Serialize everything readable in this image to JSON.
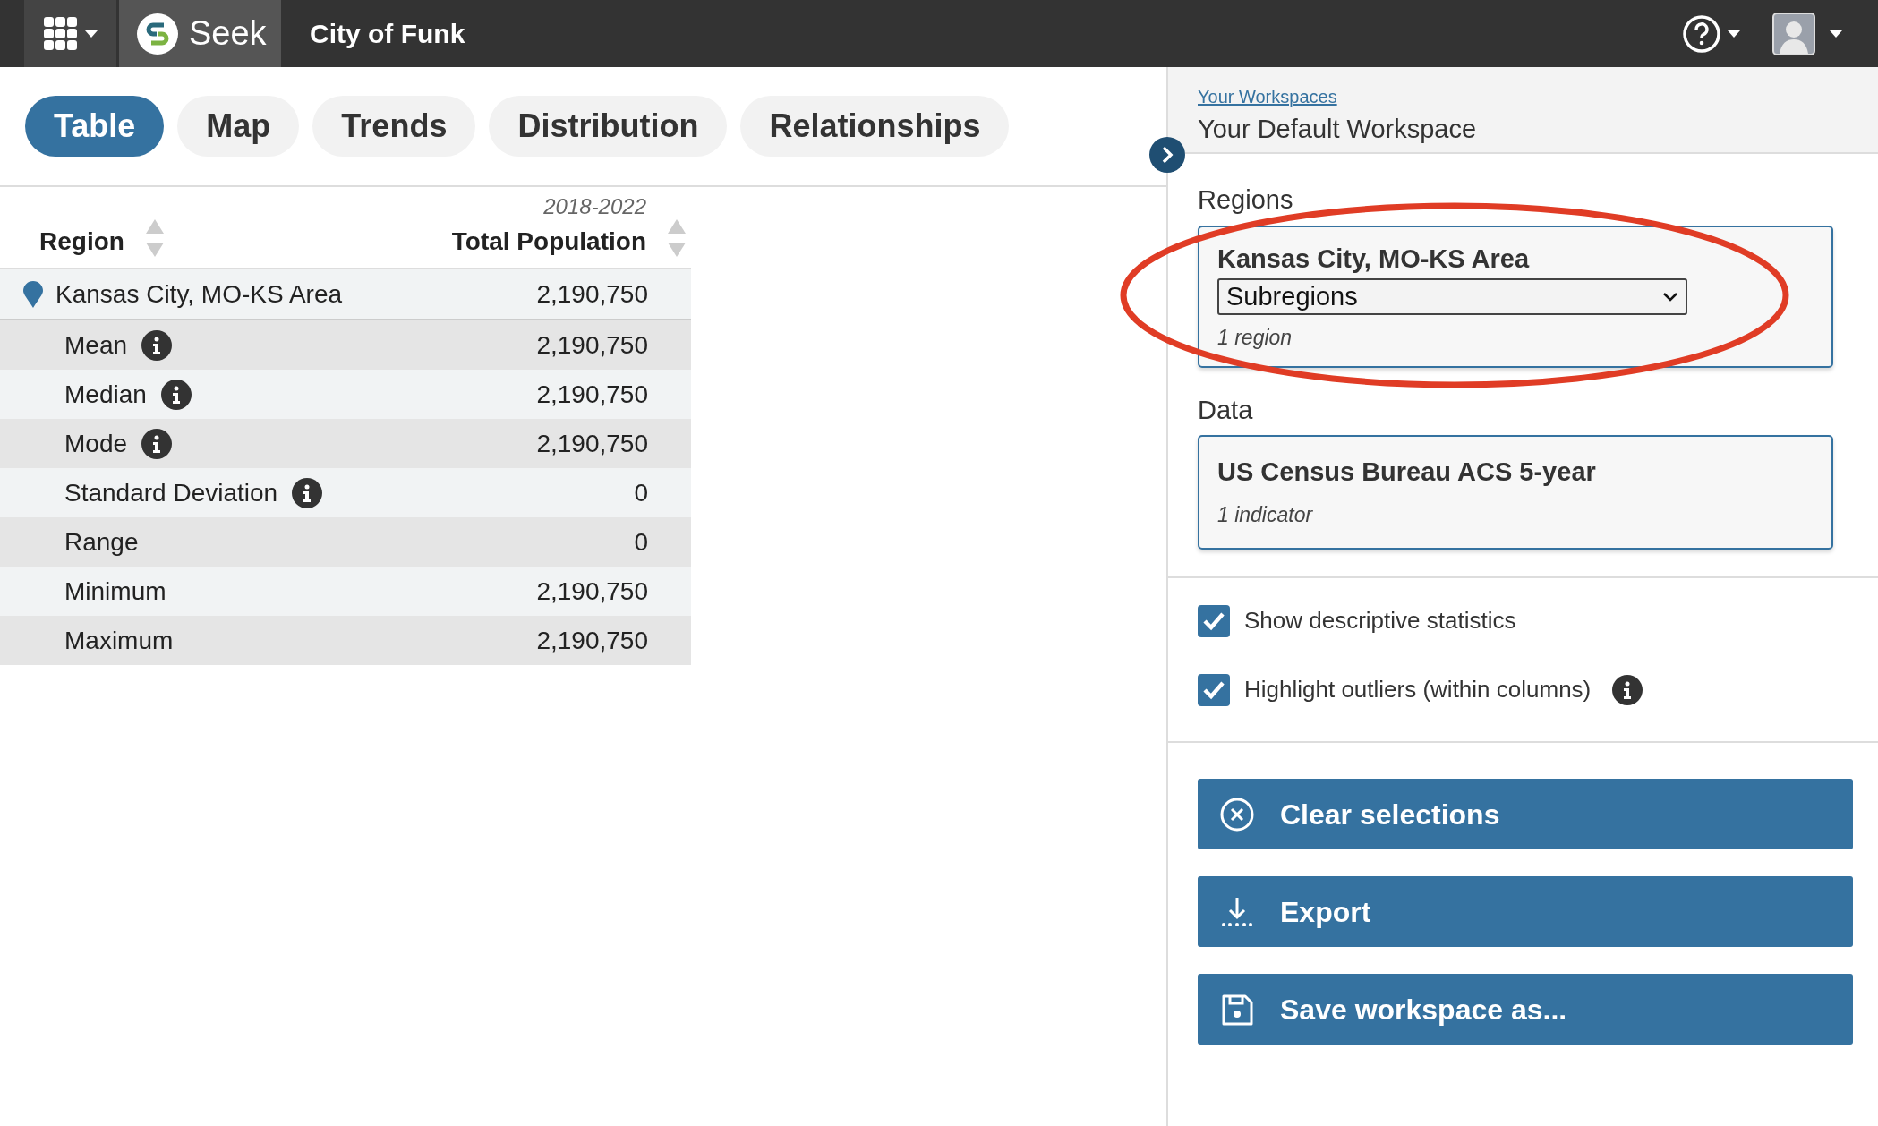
{
  "navbar": {
    "brand": "Seek",
    "title": "City of Funk"
  },
  "tabs": [
    {
      "label": "Table",
      "selected": true
    },
    {
      "label": "Map",
      "selected": false
    },
    {
      "label": "Trends",
      "selected": false
    },
    {
      "label": "Distribution",
      "selected": false
    },
    {
      "label": "Relationships",
      "selected": false
    }
  ],
  "table": {
    "columns": [
      {
        "label": "Region"
      },
      {
        "label": "Total Population",
        "sublabel": "2018-2022"
      }
    ],
    "region_row": {
      "region": "Kansas City, MO-KS Area",
      "value": "2,190,750"
    },
    "stat_rows": [
      {
        "label": "Mean",
        "info": true,
        "value": "2,190,750"
      },
      {
        "label": "Median",
        "info": true,
        "value": "2,190,750"
      },
      {
        "label": "Mode",
        "info": true,
        "value": "2,190,750"
      },
      {
        "label": "Standard Deviation",
        "info": true,
        "value": "0"
      },
      {
        "label": "Range",
        "info": false,
        "value": "0"
      },
      {
        "label": "Minimum",
        "info": false,
        "value": "2,190,750"
      },
      {
        "label": "Maximum",
        "info": false,
        "value": "2,190,750"
      }
    ]
  },
  "sidebar": {
    "breadcrumb": "Your Workspaces",
    "workspace": "Your Default Workspace",
    "regions": {
      "heading": "Regions",
      "title": "Kansas City, MO-KS Area",
      "select": "Subregions",
      "count": "1 region"
    },
    "data": {
      "heading": "Data",
      "title": "US Census Bureau ACS 5-year",
      "count": "1 indicator"
    },
    "options": [
      {
        "label": "Show descriptive statistics",
        "checked": true,
        "info": false
      },
      {
        "label": "Highlight outliers (within columns)",
        "checked": true,
        "info": true
      }
    ],
    "buttons": [
      {
        "kind": "clear",
        "label": "Clear selections"
      },
      {
        "kind": "export",
        "label": "Export"
      },
      {
        "kind": "save",
        "label": "Save workspace as..."
      }
    ]
  },
  "annotations": [
    {
      "kind": "ellipse"
    }
  ]
}
